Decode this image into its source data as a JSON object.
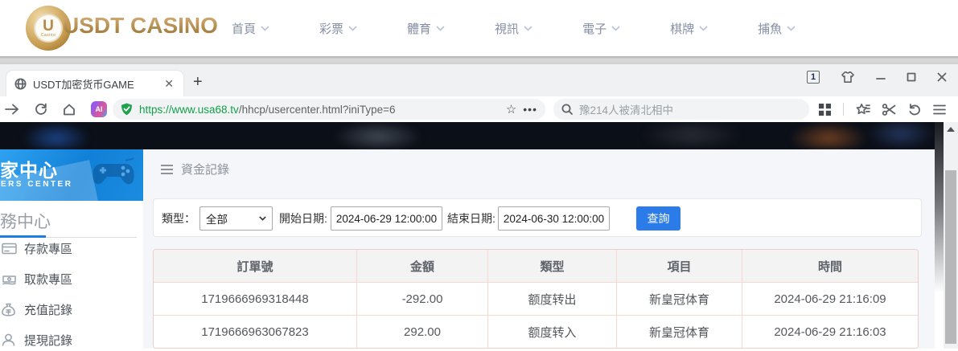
{
  "site_header": {
    "logo_text": "USDT CASINO",
    "logo_initial": "U",
    "logo_small": "Casino",
    "nav": [
      {
        "label": "首頁"
      },
      {
        "label": "彩票"
      },
      {
        "label": "體育"
      },
      {
        "label": "視訊"
      },
      {
        "label": "電子"
      },
      {
        "label": "棋牌"
      },
      {
        "label": "捕魚"
      }
    ]
  },
  "browser": {
    "tab": {
      "title": "USDT加密货币GAME",
      "close_glyph": "✕",
      "new_tab_glyph": "+"
    },
    "window_controls": {
      "tab_count": "1",
      "minimize_glyph": "—"
    },
    "address": {
      "url_secure": "https://www.usa68.tv",
      "url_path": "/hhcp/usercenter.html?iniType=6",
      "star_glyph": "☆",
      "more_glyph": "•••"
    },
    "search": {
      "placeholder": "豫214人被清北相中"
    }
  },
  "sidebar": {
    "banner_title": "家中心",
    "banner_subtitle": "ERS CENTER",
    "section_title": "務中心",
    "items": [
      {
        "label": "存款專區",
        "icon": "deposit-icon"
      },
      {
        "label": "取款專區",
        "icon": "withdraw-icon"
      },
      {
        "label": "充值記錄",
        "icon": "recharge-icon"
      },
      {
        "label": "提現記錄",
        "icon": "cashout-icon"
      }
    ]
  },
  "main": {
    "page_title": "資金記錄",
    "filters": {
      "type_label": "類型：",
      "type_value": "全部",
      "start_label": "開始日期:",
      "start_value": "2024-06-29 12:00:00",
      "end_label": "結束日期:",
      "end_value": "2024-06-30 12:00:00",
      "search_button": "查詢"
    },
    "table": {
      "headers": [
        "訂單號",
        "金額",
        "類型",
        "項目",
        "時間"
      ],
      "rows": [
        [
          "1719666969318448",
          "-292.00",
          "额度转出",
          "新皇冠体育",
          "2024-06-29 21:16:09"
        ],
        [
          "1719666963067823",
          "292.00",
          "额度转入",
          "新皇冠体育",
          "2024-06-29 21:16:03"
        ]
      ]
    }
  },
  "colors": {
    "accent_blue": "#2b7ce9",
    "secure_green": "#12a149",
    "gold": "#b5894a",
    "sidebar_blue": "#1180d8",
    "table_border": "#f2d9d2",
    "content_bg": "#f4f6f9"
  }
}
